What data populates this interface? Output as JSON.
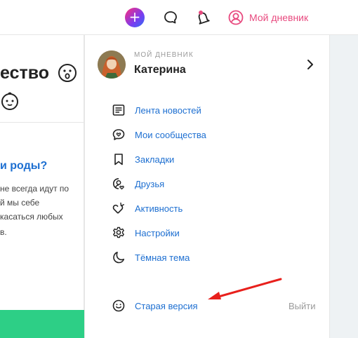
{
  "header": {
    "plus_label": "+",
    "diary_label": "Мой дневник"
  },
  "background": {
    "community_title_fragment": "ество",
    "article_title_fragment": "и роды?",
    "article_lines": [
      "не всегда идут по",
      "й мы себе",
      "касаться любых",
      "в."
    ]
  },
  "dropdown": {
    "section_label": "МОЙ ДНЕВНИК",
    "user_name": "Катерина",
    "menu_items": [
      {
        "label": "Лента новостей",
        "icon": "news-feed-icon"
      },
      {
        "label": "Мои сообщества",
        "icon": "communities-icon"
      },
      {
        "label": "Закладки",
        "icon": "bookmark-icon"
      },
      {
        "label": "Друзья",
        "icon": "friends-icon"
      },
      {
        "label": "Активность",
        "icon": "heart-icon"
      },
      {
        "label": "Настройки",
        "icon": "gear-icon"
      },
      {
        "label": "Тёмная тема",
        "icon": "moon-icon"
      }
    ],
    "old_version_label": "Старая версия",
    "logout_label": "Выйти"
  },
  "colors": {
    "link": "#1d6fd1",
    "brand_pink": "#e84a7f",
    "muted": "#9a9a9a",
    "annotation_arrow": "#e8201c",
    "green_block": "#2dcf86"
  }
}
